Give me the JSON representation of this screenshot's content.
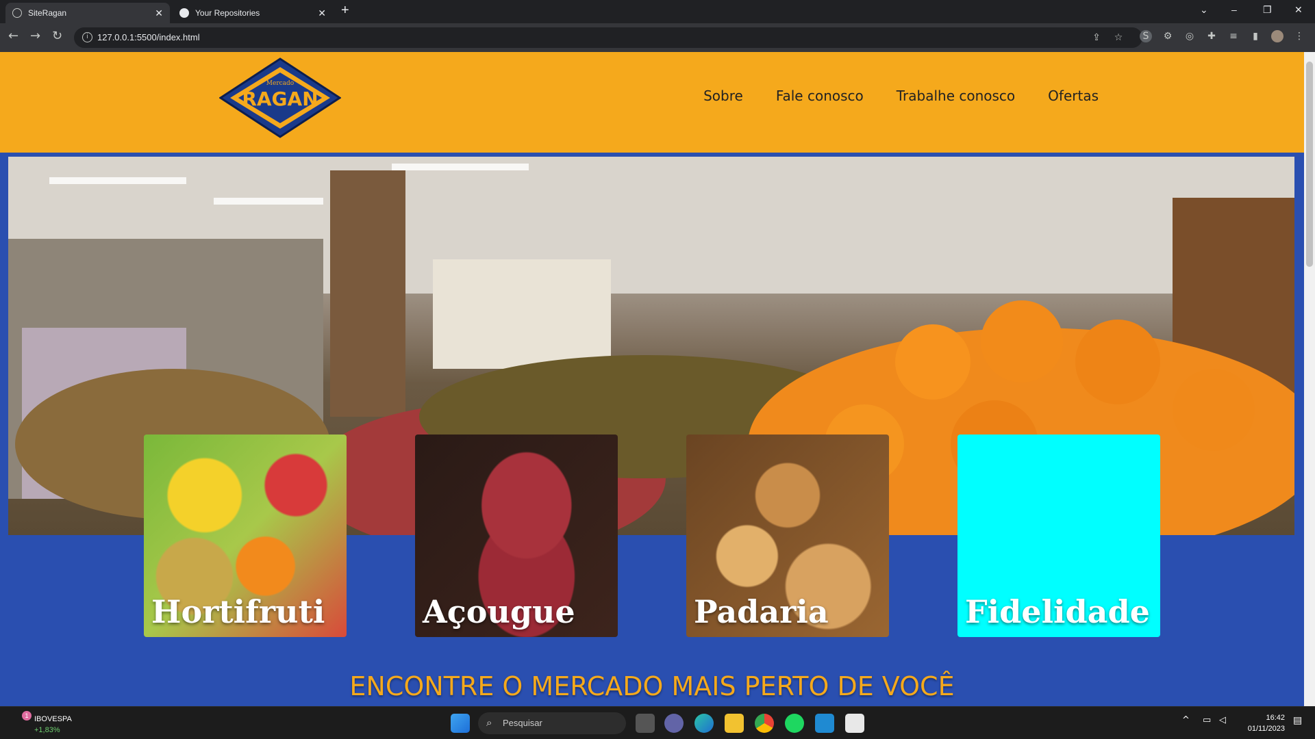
{
  "browser": {
    "tabs": [
      {
        "title": "SiteRagan",
        "active": true
      },
      {
        "title": "Your Repositories",
        "active": false
      }
    ],
    "url": "127.0.0.1:5500/index.html"
  },
  "site": {
    "logo_text_top": "Mercado",
    "logo_text": "RAGAN",
    "nav": [
      "Sobre",
      "Fale conosco",
      "Trabalhe conosco",
      "Ofertas"
    ],
    "cards": [
      "Hortifruti",
      "Açougue",
      "Padaria",
      "Fidelidade"
    ],
    "cta": "ENCONTRE O MERCADO MAIS PERTO DE VOCÊ",
    "colors": {
      "header": "#f5a91c",
      "background": "#2a4fb0",
      "fidelidade": "#00ffff"
    }
  },
  "taskbar": {
    "ticker_name": "IBOVESPA",
    "ticker_value": "+1,83%",
    "ticker_badge": "1",
    "search_placeholder": "Pesquisar",
    "time": "16:42",
    "date": "01/11/2023"
  }
}
